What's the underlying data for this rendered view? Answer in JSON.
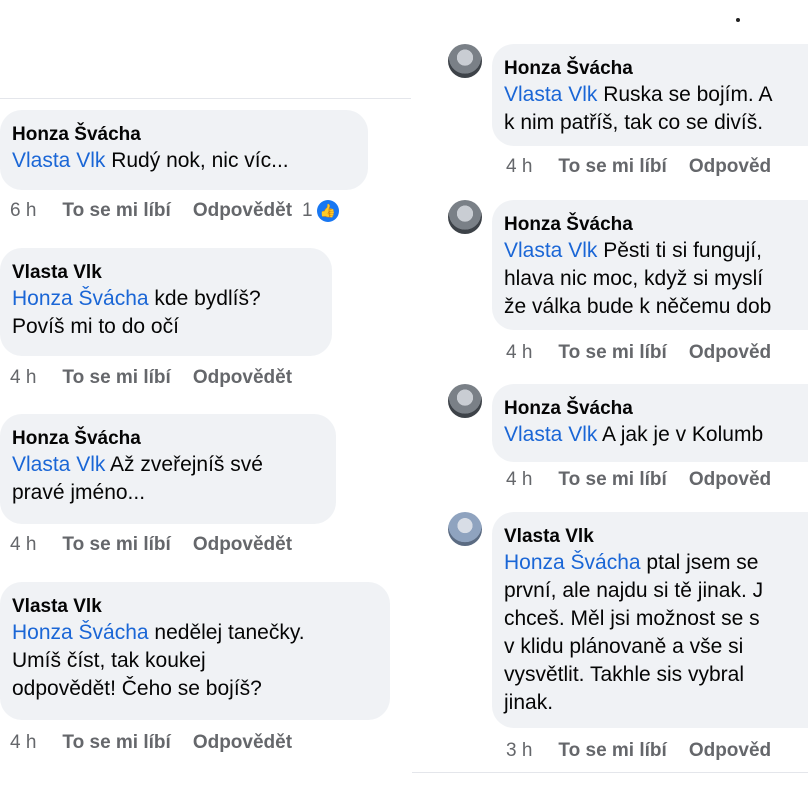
{
  "left": {
    "comments": [
      {
        "author": "Honza Švácha",
        "mention": "Vlasta Vlk",
        "line1": " Rudý nok, nic víc...",
        "line2": "",
        "line3": "",
        "time": "6 h",
        "like": "To se mi líbí",
        "reply": "Odpovědět",
        "reaction_count": "1",
        "reaction_icon": "thumbs-up-icon"
      },
      {
        "author": "Vlasta Vlk",
        "mention": "Honza Švácha",
        "line1": " kde bydlíš?",
        "line2": "Povíš mi to do očí",
        "line3": "",
        "time": "4 h",
        "like": "To se mi líbí",
        "reply": "Odpovědět"
      },
      {
        "author": "Honza Švácha",
        "mention": "Vlasta Vlk",
        "line1": " Až zveřejníš své",
        "line2": "pravé jméno...",
        "line3": "",
        "time": "4 h",
        "like": "To se mi líbí",
        "reply": "Odpovědět"
      },
      {
        "author": "Vlasta Vlk",
        "mention": "Honza Švácha",
        "line1": " nedělej tanečky.",
        "line2": "Umíš číst, tak koukej",
        "line3": "odpovědět! Čeho se bojíš?",
        "time": "4 h",
        "like": "To se mi líbí",
        "reply": "Odpovědět"
      }
    ]
  },
  "right": {
    "comments": [
      {
        "author": "Honza Švácha",
        "mention": "Vlasta Vlk",
        "lines": [
          " Ruska se bojím. A",
          "k nim patříš, tak co se divíš."
        ],
        "time": "4 h",
        "like": "To se mi líbí",
        "reply": "Odpověd"
      },
      {
        "author": "Honza Švácha",
        "mention": "Vlasta Vlk",
        "lines": [
          " Pěsti ti si fungují,",
          "hlava nic moc, když si myslí",
          "že válka bude k něčemu dob"
        ],
        "time": "4 h",
        "like": "To se mi líbí",
        "reply": "Odpověd"
      },
      {
        "author": "Honza Švácha",
        "mention": "Vlasta Vlk",
        "lines": [
          " A jak je v Kolumb"
        ],
        "time": "4 h",
        "like": "To se mi líbí",
        "reply": "Odpověd"
      },
      {
        "author": "Vlasta Vlk",
        "mention": "Honza Švácha",
        "lines": [
          " ptal jsem se",
          "první,  ale najdu si tě jinak. J",
          "chceš.  Měl jsi možnost se s",
          "v klidu plánovaně a vše si",
          "vysvětlit. Takhle sis vybral",
          "jinak."
        ],
        "time": "3 h",
        "like": "To se mi líbí",
        "reply": "Odpověd"
      }
    ]
  }
}
